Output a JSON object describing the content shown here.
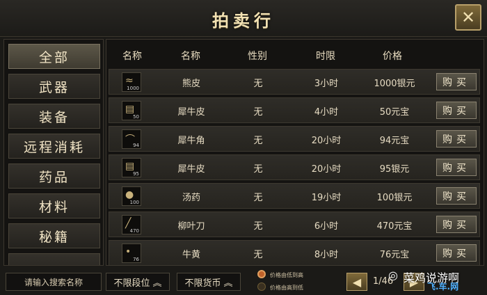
{
  "window": {
    "title": "拍卖行",
    "close_label": "✕"
  },
  "sidebar": {
    "items": [
      {
        "label": "全部",
        "active": true
      },
      {
        "label": "武器"
      },
      {
        "label": "装备"
      },
      {
        "label": "远程消耗"
      },
      {
        "label": "药品"
      },
      {
        "label": "材料"
      },
      {
        "label": "秘籍"
      }
    ]
  },
  "table": {
    "headers": [
      "名称",
      "名称",
      "性别",
      "时限",
      "价格"
    ],
    "buy_label": "购买",
    "rows": [
      {
        "icon": "pelt-icon",
        "qty": "1000",
        "name": "熊皮",
        "gender": "无",
        "time": "3小时",
        "price": "1000银元"
      },
      {
        "icon": "hide-icon",
        "qty": "50",
        "name": "犀牛皮",
        "gender": "无",
        "time": "4小时",
        "price": "50元宝"
      },
      {
        "icon": "horn-icon",
        "qty": "94",
        "name": "犀牛角",
        "gender": "无",
        "time": "20小时",
        "price": "94元宝"
      },
      {
        "icon": "hide-icon",
        "qty": "95",
        "name": "犀牛皮",
        "gender": "无",
        "time": "20小时",
        "price": "95银元"
      },
      {
        "icon": "potion-icon",
        "qty": "100",
        "name": "汤药",
        "gender": "无",
        "time": "19小时",
        "price": "100银元"
      },
      {
        "icon": "blade-icon",
        "qty": "470",
        "name": "柳叶刀",
        "gender": "无",
        "time": "6小时",
        "price": "470元宝"
      },
      {
        "icon": "bezoar-icon",
        "qty": "76",
        "name": "牛黄",
        "gender": "无",
        "time": "8小时",
        "price": "76元宝"
      }
    ]
  },
  "bottom": {
    "search_placeholder": "请输入搜索名称",
    "filter_level": "不限段位",
    "filter_currency": "不限货币",
    "sort_asc": "价格由低到高",
    "sort_desc": "价格由高到低",
    "page": "1/46"
  },
  "watermark": {
    "text": "菜鸡说游啊",
    "site": "飞.车.网"
  },
  "colors": {
    "accent": "#b8a06a",
    "panel": "#141311"
  }
}
